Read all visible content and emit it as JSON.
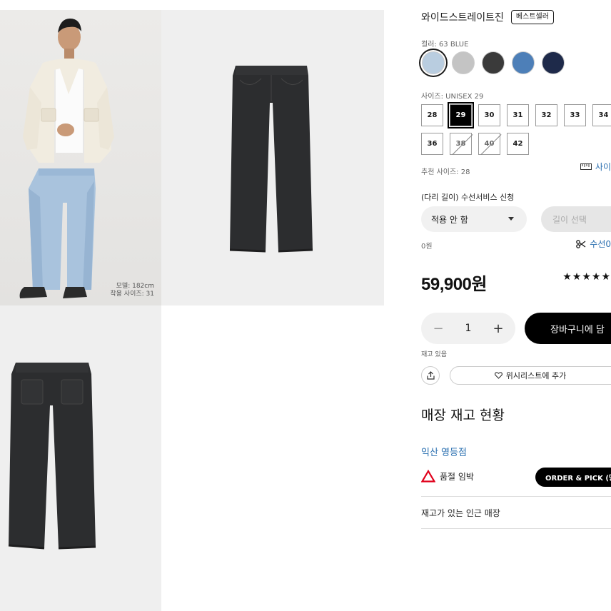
{
  "gallery": {
    "model_caption_line1": "모델: 182cm",
    "model_caption_line2": "착용 사이즈: 31"
  },
  "product": {
    "name": "와이드스트레이트진",
    "badge": "베스트셀러",
    "color_label": "컬러: 63 BLUE",
    "colors": [
      {
        "hex": "#b9cde0",
        "selected": true
      },
      {
        "hex": "#c4c4c4",
        "selected": false
      },
      {
        "hex": "#3a3a3a",
        "selected": false
      },
      {
        "hex": "#4d7fb8",
        "selected": false
      },
      {
        "hex": "#1e2a4a",
        "selected": false
      }
    ],
    "size_label": "사이즈: UNISEX 29",
    "sizes_row1": [
      "28",
      "29",
      "30",
      "31",
      "32",
      "33",
      "34"
    ],
    "sizes_row2": [
      "36",
      "38",
      "40",
      "42"
    ],
    "selected_size": "29",
    "soldout_sizes": [
      "38",
      "40"
    ],
    "recommended_size": "추천 사이즈: 28",
    "size_guide_link": "사이",
    "alteration_label": "(다리 길이) 수선서비스 신청",
    "alteration_option": "적용 안 함",
    "length_select": "길이 선택",
    "alteration_fee": "0원",
    "alteration_link": "수선0",
    "price": "59,900원",
    "stars": "★★★★★",
    "quantity": "1",
    "add_to_cart": "장바구니에 담",
    "stock_note": "재고 있음",
    "wishlist": "위시리스트에 추가"
  },
  "stores": {
    "title": "매장 재고 현황",
    "store_name": "익산 영등점",
    "status": "품절 임박",
    "order_pick": "ORDER & PICK (당",
    "nearby": "재고가 있는 인근 매장"
  }
}
